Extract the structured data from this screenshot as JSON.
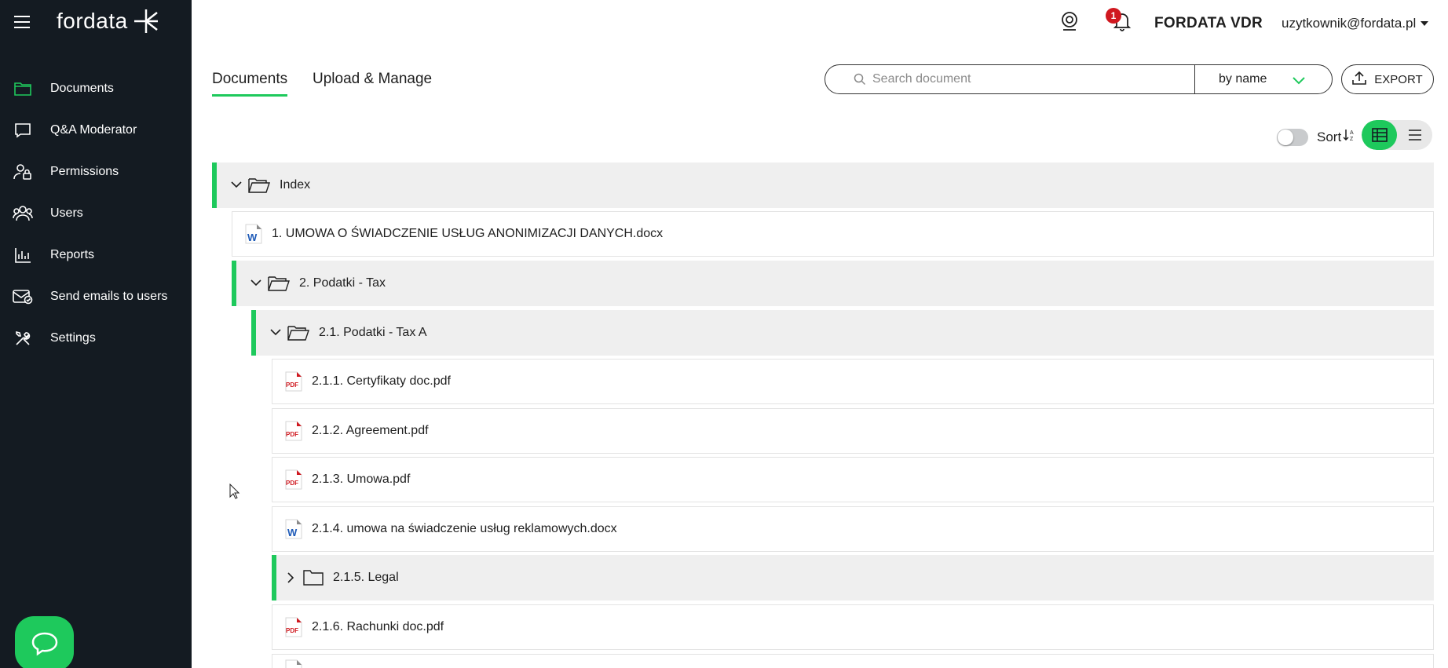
{
  "app": {
    "logo_text": "fordata",
    "vdr_name": "FORDATA VDR",
    "user_email": "uzytkownik@fordata.pl",
    "notification_count": "1",
    "accent_color": "#1ec95c",
    "sidebar_bg": "#141b22"
  },
  "sidebar": {
    "items": [
      {
        "label": "Documents",
        "icon": "folder-icon"
      },
      {
        "label": "Q&A Moderator",
        "icon": "chat-bubble-icon"
      },
      {
        "label": "Permissions",
        "icon": "user-lock-icon"
      },
      {
        "label": "Users",
        "icon": "users-icon"
      },
      {
        "label": "Reports",
        "icon": "bar-chart-icon"
      },
      {
        "label": "Send emails to users",
        "icon": "mail-check-icon"
      },
      {
        "label": "Settings",
        "icon": "tools-icon"
      }
    ]
  },
  "tabs": [
    {
      "label": "Documents",
      "active": true
    },
    {
      "label": "Upload & Manage",
      "active": false
    }
  ],
  "search": {
    "placeholder": "Search document",
    "value": "",
    "mode": "by name"
  },
  "export_label": "EXPORT",
  "sort_label": "Sort",
  "tree": [
    {
      "type": "folder",
      "label": "Index",
      "expanded": true,
      "level": 0
    },
    {
      "type": "docx",
      "label": "1. UMOWA O ŚWIADCZENIE USŁUG ANONIMIZACJI DANYCH.docx",
      "level": 1
    },
    {
      "type": "folder",
      "label": "2. Podatki - Tax",
      "expanded": true,
      "level": 1
    },
    {
      "type": "folder",
      "label": "2.1. Podatki - Tax A",
      "expanded": true,
      "level": 2
    },
    {
      "type": "pdf",
      "label": "2.1.1. Certyfikaty doc.pdf",
      "level": 3
    },
    {
      "type": "pdf",
      "label": "2.1.2. Agreement.pdf",
      "level": 3
    },
    {
      "type": "pdf",
      "label": "2.1.3. Umowa.pdf",
      "level": 3
    },
    {
      "type": "docx",
      "label": "2.1.4. umowa na świadczenie usług reklamowych.docx",
      "level": 3
    },
    {
      "type": "folder",
      "label": "2.1.5. Legal",
      "expanded": false,
      "level": 3
    },
    {
      "type": "pdf",
      "label": "2.1.6. Rachunki doc.pdf",
      "level": 3
    }
  ]
}
